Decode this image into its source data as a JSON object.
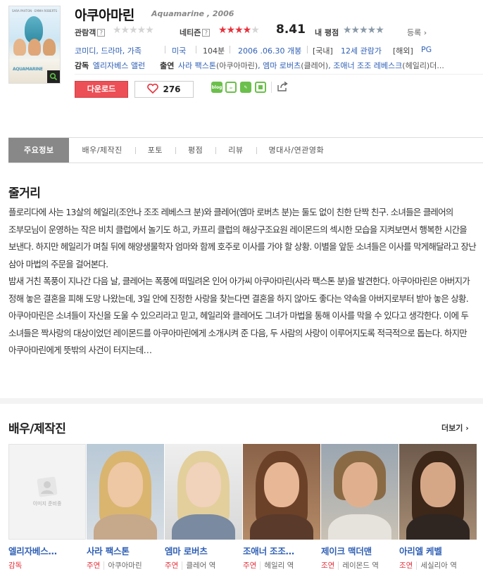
{
  "movie": {
    "title": "아쿠아마린",
    "en_title": "Aquamarine , 2006",
    "poster": {
      "top_text": "SARA PAXTON · EMMA ROBERTS · JOANNA LEVESQUE",
      "title_text": "AQUAMARINE"
    }
  },
  "ratings": {
    "audience_label": "관람객",
    "audience_stars": 0,
    "netizen_label": "네티즌",
    "netizen_stars": 4,
    "netizen_score": "8.41",
    "my_label": "내 평점",
    "register": "등록"
  },
  "meta": {
    "genres": "코미디, 드라마, 가족",
    "country": "미국",
    "runtime": "104분",
    "release": "2006 .06.30 개봉",
    "rating_domestic_label": "[국내]",
    "rating_domestic": "12세 관람가",
    "rating_foreign_label": "[해외]",
    "rating_foreign": "PG"
  },
  "credits": {
    "director_label": "감독",
    "director": "엘리자베스 앨런",
    "cast_label": "출연",
    "cast": [
      {
        "name": "사라 팩스톤",
        "role": "(아쿠아마린)"
      },
      {
        "name": "엠마 로버츠",
        "role": "(클레어)"
      },
      {
        "name": "조애너 조조 레베스크",
        "role": "(헤일리)"
      }
    ],
    "tail": "더..."
  },
  "actions": {
    "download": "다운로드",
    "like_count": "276",
    "sns": [
      "blog",
      "cafe",
      "me",
      "line"
    ]
  },
  "tabs": [
    "주요정보",
    "배우/제작진",
    "포토",
    "평점",
    "리뷰",
    "명대사/연관영화"
  ],
  "synopsis": {
    "heading": "줄거리",
    "para1": "플로리다에 사는 13살의 헤일리(조안나 조조 레베스크 분)와 클레어(엠마 로버츠 분)는 둘도 없이 친한 단짝 친구. 소녀들은 클레어의 조부모님이 운영하는 작은 비치 클럽에서 놀기도 하고, 카프리 클럽의 해상구조요원 레이몬드의 섹시한 모습을 지켜보면서 행복한 시간을 보낸다. 하지만 헤일리가 며칠 뒤에 해양생물학자 엄마와 함께 호주로 이사를 가야 할 상황. 이별을 앞둔 소녀들은 이사를 막게해달라고 장난 삼아 마법의 주문을 걸어본다.",
    "para2": " 밤새 거친 폭풍이 지나간 다음 날, 클레어는 폭풍에 떠밀려온 인어 아가씨 아쿠아마린(사라 팩스톤 분)을 발견한다. 아쿠아마린은 아버지가 정해 놓은 결혼을 피해 도망 나왔는데, 3일 안에 진정한 사랑을 찾는다면 결혼을 하지 않아도 좋다는 약속을 아버지로부터 받아 놓은 상황. 아쿠아마린은 소녀들이 자신을 도울 수 있으리라고 믿고, 헤일리와 클레어도 그녀가 마법을 통해 이사를 막을 수 있다고 생각한다. 이에 두 소녀들은 짝사랑의 대상이었던 레이몬드를 아쿠아마린에게 소개시켜 준 다음, 두 사람의 사랑이 이루어지도록 적극적으로 돕는다. 하지만 아쿠아마린에게 뜻밖의 사건이 터지는데…"
  },
  "cast_section": {
    "heading": "배우/제작진",
    "more": "더보기",
    "no_image": "이미지 준비중",
    "items": [
      {
        "name": "엘리자베스…",
        "type": "감독",
        "character": ""
      },
      {
        "name": "사라 팩스톤",
        "type": "주연",
        "character": "아쿠아마린"
      },
      {
        "name": "엠마 로버츠",
        "type": "주연",
        "character": "클레어 역"
      },
      {
        "name": "조애너 조조…",
        "type": "주연",
        "character": "헤일리 역"
      },
      {
        "name": "제이크 맥더맨",
        "type": "조연",
        "character": "레이몬드 역"
      },
      {
        "name": "아리엘 케벨",
        "type": "조연",
        "character": "세실리아 역"
      }
    ]
  },
  "colors": {
    "accent_red": "#e5323c",
    "link_blue": "#3060b5",
    "tab_active": "#888888",
    "download_btn": "#ec4f55"
  }
}
